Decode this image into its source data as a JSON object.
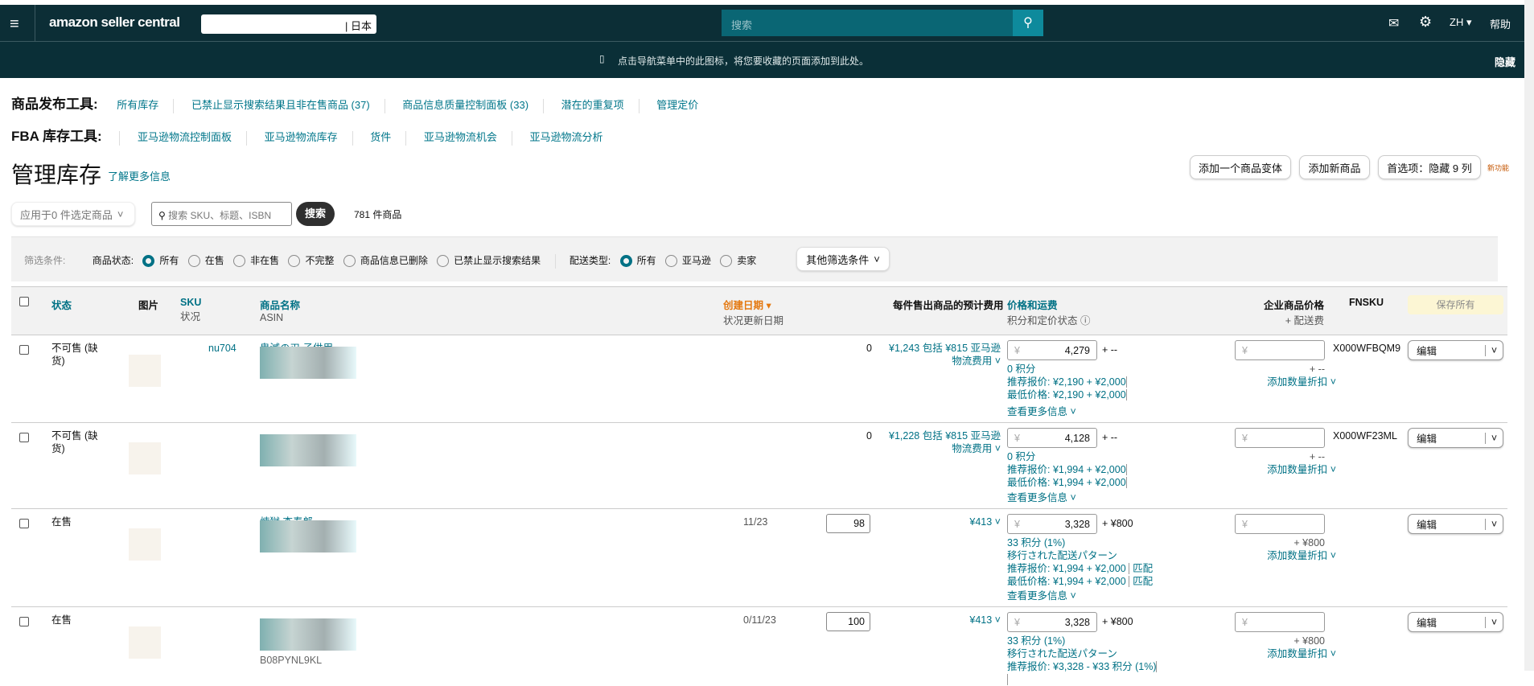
{
  "nav": {
    "logo": "amazon seller central",
    "marketplace": "| 日本",
    "search_placeholder": "搜索",
    "lang": "ZH ▾",
    "help": "帮助"
  },
  "bookmark": {
    "text": "点击导航菜单中的此图标，将您要收藏的页面添加到此处。",
    "hide": "隐藏"
  },
  "tools": {
    "listing_label": "商品发布工具:",
    "listing_links": [
      "所有库存",
      "已禁止显示搜索结果且非在售商品 (37)",
      "商品信息质量控制面板 (33)",
      "潜在的重复项",
      "管理定价"
    ],
    "fba_label": "FBA 库存工具:",
    "fba_links": [
      "亚马逊物流控制面板",
      "亚马逊物流库存",
      "货件",
      "亚马逊物流机会",
      "亚马逊物流分析"
    ]
  },
  "page": {
    "title": "管理库存",
    "learn_more": "了解更多信息",
    "add_variation": "添加一个商品变体",
    "add_product": "添加新商品",
    "preferences": "首选项：隐藏 9 列",
    "new_feature": "新功能"
  },
  "search": {
    "bulk": "应用于0 件选定商品",
    "placeholder": "搜索 SKU、标题、ISBN",
    "button": "搜索",
    "count": "781 件商品"
  },
  "filters": {
    "label": "筛选条件:",
    "status_label": "商品状态:",
    "status_options": [
      "所有",
      "在售",
      "非在售",
      "不完整",
      "商品信息已删除",
      "已禁止显示搜索结果"
    ],
    "fulfill_label": "配送类型:",
    "fulfill_options": [
      "所有",
      "亚马逊",
      "卖家"
    ],
    "more": "其他筛选条件"
  },
  "table": {
    "headers": {
      "status": "状态",
      "image": "图片",
      "sku": "SKU",
      "sku_sub": "状况",
      "name": "商品名称",
      "name_sub": "ASIN",
      "created": "创建日期 ▾",
      "created_sub": "状况更新日期",
      "fees": "每件售出商品的预计费用",
      "price": "价格和运费",
      "price_sub": "积分和定价状态 ⓘ",
      "biz": "企业商品价格",
      "biz_sub": "+ 配送费",
      "fnsku": "FNSKU",
      "save_all": "保存所有"
    },
    "rows": [
      {
        "status": "不可售 (缺货)",
        "sku": "nu704",
        "name": "鬼滅の刃 子供用",
        "asin": "",
        "created": "",
        "qty": "0",
        "fee": "¥1,243 包括 ¥815 亚马逊物流费用 ˅",
        "price": "4,279",
        "ship": "+ --",
        "points": "0 积分",
        "pattern": "",
        "rec": "推荐报价:  ¥2,190 + ¥2,000",
        "low": "最低价格:  ¥2,190 + ¥2,000",
        "match": "",
        "biz_ship": "+ --",
        "discount": "添加数量折扣 ˅",
        "fnsku": "X000WFBQM9",
        "more": "查看更多信息 ˅",
        "edit": "编辑"
      },
      {
        "status": "不可售 (缺货)",
        "sku": "",
        "name": "",
        "asin": "",
        "created": "",
        "qty": "0",
        "fee": "¥1,228 包括 ¥815 亚马逊物流费用 ˅",
        "price": "4,128",
        "ship": "+ --",
        "points": "0 积分",
        "pattern": "",
        "rec": "推荐报价:  ¥1,994 + ¥2,000",
        "low": "最低价格:  ¥1,994 + ¥2,000",
        "match": "",
        "biz_ship": "+ --",
        "discount": "添加数量折扣 ˅",
        "fnsku": "X000WF23ML",
        "more": "查看更多信息 ˅",
        "edit": "编辑"
      },
      {
        "status": "在售",
        "sku": "",
        "name": "煉獄 杏寿郎",
        "asin": "",
        "created": "11/23",
        "qty": "98",
        "fee": "¥413 ˅",
        "price": "3,328",
        "ship": "+ ¥800",
        "points": "33 积分 (1%)",
        "pattern": "移行された配送パターン",
        "rec": "推荐报价:  ¥1,994 + ¥2,000",
        "low": "最低价格:  ¥1,994 + ¥2,000",
        "match": "匹配",
        "biz_ship": "+ ¥800",
        "discount": "添加数量折扣 ˅",
        "fnsku": "",
        "more": "查看更多信息 ˅",
        "edit": "编辑"
      },
      {
        "status": "在售",
        "sku": "",
        "name": "",
        "asin": "B08PYNL9KL",
        "created": "0/11/23",
        "qty": "100",
        "fee": "¥413 ˅",
        "price": "3,328",
        "ship": "+ ¥800",
        "points": "33 积分 (1%)",
        "pattern": "移行された配送パターン",
        "rec": "推荐报价:  ¥3,328 - ¥33 积分 (1%)",
        "low": "",
        "match": "",
        "biz_ship": "+ ¥800",
        "discount": "添加数量折扣 ˅",
        "fnsku": "",
        "more": "",
        "edit": "编辑"
      }
    ]
  }
}
